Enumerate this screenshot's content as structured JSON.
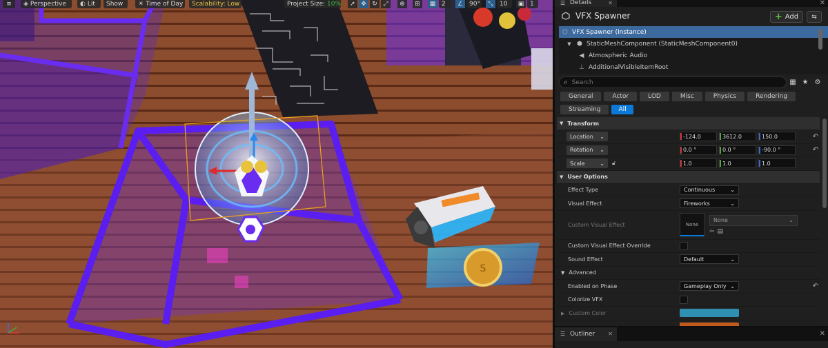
{
  "viewport": {
    "toolbar": {
      "menu_icon": "hamburger-icon",
      "perspective": "Perspective",
      "lit": "Lit",
      "show": "Show",
      "time_of_day": "Time of Day",
      "scalability": "Scalability: Low",
      "project_size_label": "Project Size:",
      "project_size_value": "10%",
      "fov": "90°",
      "camera_speed": "2",
      "snap_value": "10",
      "grid_value": "1"
    },
    "colors": {
      "floor": "#8a4a2c",
      "glass": "#6a2cf0",
      "accent": "#0c79d8"
    }
  },
  "details": {
    "tab_label": "Details",
    "actor_name": "VFX Spawner",
    "add_label": "Add",
    "tree": [
      {
        "label": "VFX Spawner (Instance)",
        "icon": "actor-icon",
        "selected": true
      },
      {
        "label": "StaticMeshComponent (StaticMeshComponent0)",
        "icon": "mesh-icon",
        "selected": false
      },
      {
        "label": "Atmospheric Audio",
        "icon": "audio-icon",
        "selected": false
      },
      {
        "label": "AdditionalVisibleItemRoot",
        "icon": "scene-icon",
        "selected": false
      }
    ],
    "search_placeholder": "Search",
    "filters": [
      "General",
      "Actor",
      "LOD",
      "Misc",
      "Physics",
      "Rendering",
      "Streaming",
      "All"
    ],
    "active_filter": "All",
    "transform": {
      "title": "Transform",
      "location": {
        "label": "Location",
        "x": "-124.0",
        "y": "3612.0",
        "z": "150.0"
      },
      "rotation": {
        "label": "Rotation",
        "x": "0.0 °",
        "y": "0.0 °",
        "z": "-90.0 °"
      },
      "scale": {
        "label": "Scale",
        "x": "1.0",
        "y": "1.0",
        "z": "1.0"
      }
    },
    "user_options": {
      "title": "User Options",
      "effect_type": {
        "label": "Effect Type",
        "value": "Continuous"
      },
      "visual_effect": {
        "label": "Visual Effect",
        "value": "Fireworks"
      },
      "custom_visual_effect": {
        "label": "Custom Visual Effect",
        "thumb": "None",
        "value": "None"
      },
      "custom_override": {
        "label": "Custom Visual Effect Override"
      },
      "sound_effect": {
        "label": "Sound Effect",
        "value": "Default"
      }
    },
    "advanced": {
      "title": "Advanced",
      "enabled_on_phase": {
        "label": "Enabled on Phase",
        "value": "Gameplay Only"
      },
      "colorize_vfx": {
        "label": "Colorize VFX"
      },
      "custom_color": {
        "label": "Custom Color",
        "color": "#2e8fb0"
      },
      "next_color": "#c05a1e"
    }
  },
  "outliner": {
    "tab_label": "Outliner"
  }
}
